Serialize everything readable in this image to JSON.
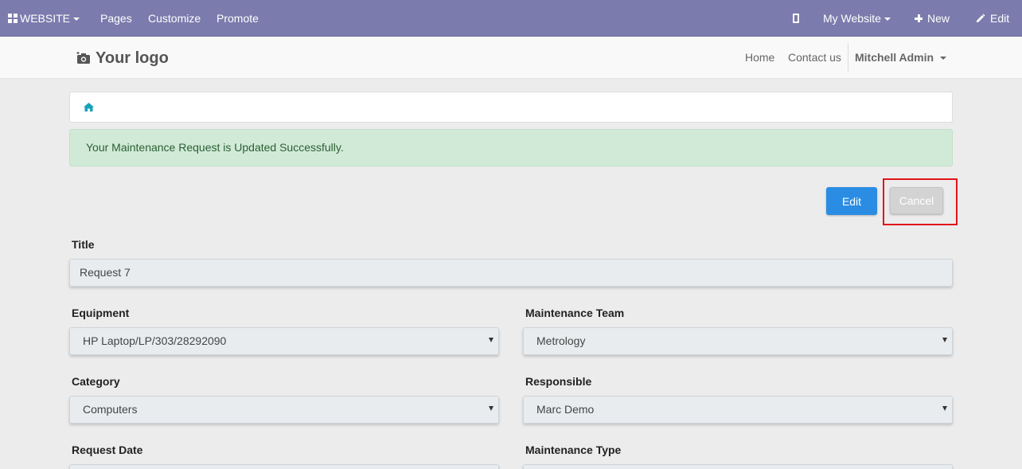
{
  "adminbar": {
    "website_label": "WEBSITE",
    "pages_label": "Pages",
    "customize_label": "Customize",
    "promote_label": "Promote",
    "my_website_label": "My Website",
    "new_label": "New",
    "edit_label": "Edit",
    "background_color": "#7c7bad"
  },
  "header": {
    "logo_text": "Your logo",
    "nav": {
      "home": "Home",
      "contact": "Contact us"
    },
    "user_name": "Mitchell Admin"
  },
  "alert": {
    "message": "Your Maintenance Request is Updated Successfully."
  },
  "actions": {
    "edit_label": "Edit",
    "cancel_label": "Cancel",
    "edit_color": "#2a8de3"
  },
  "form": {
    "title": {
      "label": "Title",
      "value": "Request 7"
    },
    "equipment": {
      "label": "Equipment",
      "value": "HP Laptop/LP/303/28292090"
    },
    "maintenance_team": {
      "label": "Maintenance Team",
      "value": "Metrology"
    },
    "category": {
      "label": "Category",
      "value": "Computers"
    },
    "responsible": {
      "label": "Responsible",
      "value": "Marc Demo"
    },
    "request_date": {
      "label": "Request Date"
    },
    "maintenance_type": {
      "label": "Maintenance Type"
    }
  }
}
